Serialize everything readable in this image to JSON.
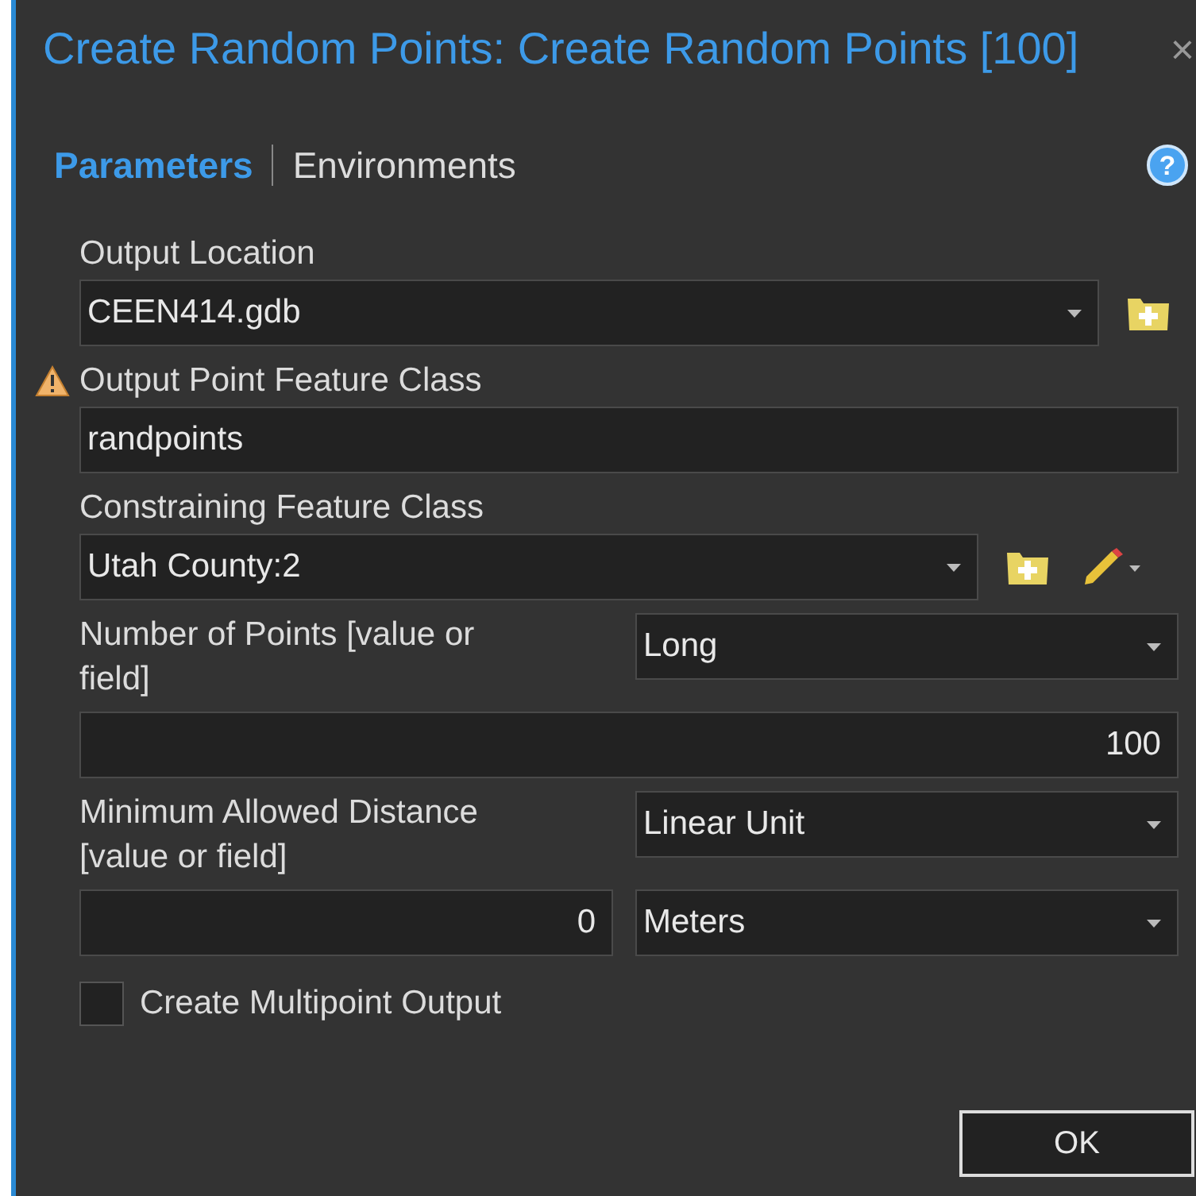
{
  "window": {
    "title": "Create Random Points: Create Random Points [100]",
    "close": "×"
  },
  "tabs": [
    {
      "label": "Parameters",
      "selected": true
    },
    {
      "label": "Environments",
      "selected": false
    }
  ],
  "help": "?",
  "parameters": [
    {
      "kind": "dropdown",
      "label": "Output Location",
      "warning": false,
      "value": "CEEN414.gdb",
      "browse": true,
      "edit": false
    },
    {
      "kind": "text",
      "label": "Output Point Feature Class",
      "warning": true,
      "value": "randpoints"
    },
    {
      "kind": "dropdown",
      "label": "Constraining Feature Class",
      "warning": false,
      "value": "Utah County:2",
      "browse": true,
      "edit": true
    },
    {
      "kind": "value_or_field",
      "label": "Number of Points [value or field]",
      "warning": false,
      "type": "Long",
      "value": "100"
    },
    {
      "kind": "linear_unit",
      "label": "Minimum Allowed Distance [value or field]",
      "warning": false,
      "type": "Linear Unit",
      "value": "0",
      "unit": "Meters"
    },
    {
      "kind": "checkbox",
      "label": "Create Multipoint Output",
      "warning": false,
      "checked": false
    }
  ],
  "ok_button": "OK"
}
